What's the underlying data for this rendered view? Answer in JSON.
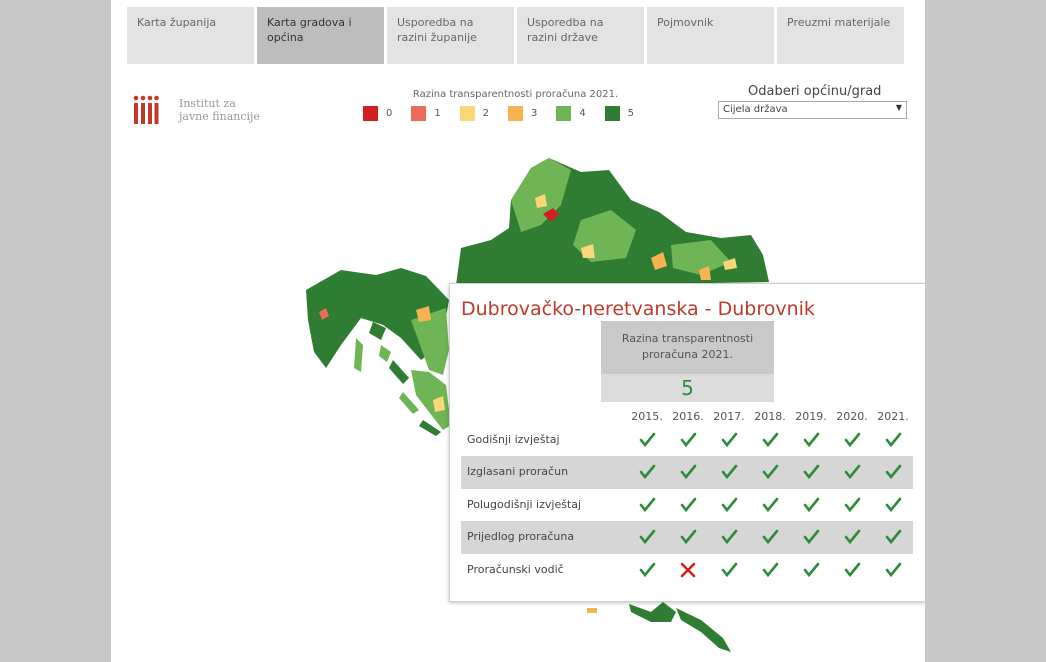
{
  "tabs": [
    {
      "label": "Karta županija",
      "active": false
    },
    {
      "label": "Karta gradova i općina",
      "active": true
    },
    {
      "label": "Usporedba na razini županije",
      "active": false
    },
    {
      "label": "Usporedba na razini države",
      "active": false
    },
    {
      "label": "Pojmovnik",
      "active": false
    },
    {
      "label": "Preuzmi materijale",
      "active": false
    }
  ],
  "logo": {
    "line1": "Institut za",
    "line2": "javne financije",
    "color": "#c0392b"
  },
  "legend": {
    "title": "Razina transparentnosti proračuna 2021.",
    "items": [
      {
        "label": "0",
        "color": "#d0201f"
      },
      {
        "label": "1",
        "color": "#ea6b5a"
      },
      {
        "label": "2",
        "color": "#fbd777"
      },
      {
        "label": "3",
        "color": "#f7b34f"
      },
      {
        "label": "4",
        "color": "#6fb556"
      },
      {
        "label": "5",
        "color": "#2f7d32"
      }
    ]
  },
  "picker": {
    "title": "Odaberi općinu/grad",
    "value": "Cijela država"
  },
  "tooltip": {
    "title": "Dubrovačko-neretvanska - Dubrovnik",
    "level_header_line1": "Razina transparentnosti",
    "level_header_line2": "proračuna  2021.",
    "level_value": "5",
    "years": [
      "2015.",
      "2016.",
      "2017.",
      "2018.",
      "2019.",
      "2020.",
      "2021."
    ],
    "rows": [
      {
        "label": "Godišnji izvještaj",
        "values": [
          true,
          true,
          true,
          true,
          true,
          true,
          true
        ]
      },
      {
        "label": "Izglasani proračun",
        "values": [
          true,
          true,
          true,
          true,
          true,
          true,
          true
        ]
      },
      {
        "label": "Polugodišnji izvještaj",
        "values": [
          true,
          true,
          true,
          true,
          true,
          true,
          true
        ]
      },
      {
        "label": "Prijedlog proračuna",
        "values": [
          true,
          true,
          true,
          true,
          true,
          true,
          true
        ]
      },
      {
        "label": "Proračunski vodič",
        "values": [
          true,
          false,
          true,
          true,
          true,
          true,
          true
        ]
      }
    ],
    "check_color": "#2e8b3a",
    "cross_color": "#d0201f"
  }
}
